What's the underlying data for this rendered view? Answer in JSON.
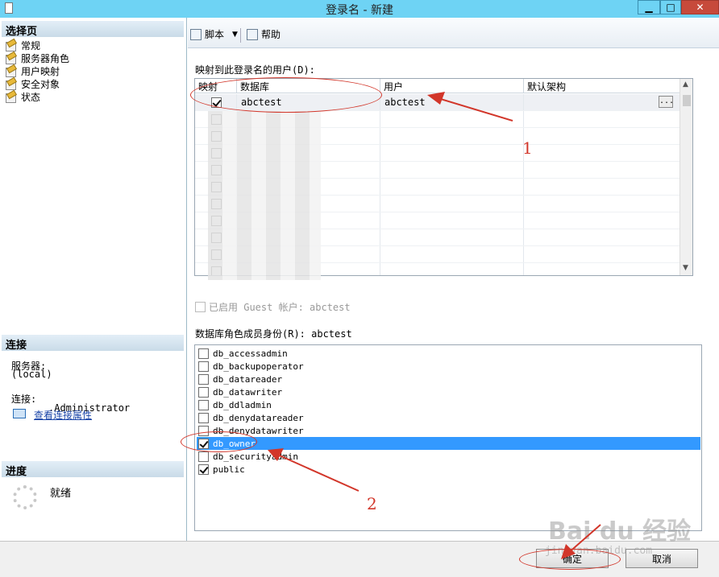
{
  "window": {
    "title": "登录名 - 新建",
    "min_glyph": "▁",
    "max_glyph": "□",
    "close_glyph": "✕"
  },
  "left": {
    "select_page_header": "选择页",
    "pages": [
      "常规",
      "服务器角色",
      "用户映射",
      "安全对象",
      "状态"
    ],
    "connection_header": "连接",
    "server_label": "服务器:",
    "server_value": "(local)",
    "connection_label": "连接:",
    "connection_value": ".Administrator",
    "view_props_link": "查看连接属性",
    "progress_header": "进度",
    "status": "就绪"
  },
  "toolbar": {
    "script_label": "脚本",
    "help_label": "帮助"
  },
  "mapping": {
    "label": "映射到此登录名的用户(D):",
    "columns": [
      "映射",
      "数据库",
      "用户",
      "默认架构"
    ],
    "rows": [
      {
        "checked": true,
        "database": "abctest",
        "user": "abctest",
        "schema": ""
      },
      {
        "checked": false
      },
      {
        "checked": false
      },
      {
        "checked": false
      },
      {
        "checked": false
      },
      {
        "checked": false
      },
      {
        "checked": false
      },
      {
        "checked": false
      },
      {
        "checked": false
      },
      {
        "checked": false
      },
      {
        "checked": false
      }
    ],
    "ellipsis": "..."
  },
  "guest": {
    "label": "已启用 Guest 帐户: abctest",
    "checked": false
  },
  "roles": {
    "label": "数据库角色成员身份(R): abctest",
    "items": [
      {
        "name": "db_accessadmin",
        "checked": false
      },
      {
        "name": "db_backupoperator",
        "checked": false
      },
      {
        "name": "db_datareader",
        "checked": false
      },
      {
        "name": "db_datawriter",
        "checked": false
      },
      {
        "name": "db_ddladmin",
        "checked": false
      },
      {
        "name": "db_denydatareader",
        "checked": false
      },
      {
        "name": "db_denydatawriter",
        "checked": false
      },
      {
        "name": "db_owner",
        "checked": true,
        "highlighted": true
      },
      {
        "name": "db_securityadmin",
        "checked": false
      },
      {
        "name": "public",
        "checked": true
      }
    ]
  },
  "buttons": {
    "ok": "确定",
    "cancel": "取消"
  },
  "annotations": {
    "one": "1",
    "two": "2",
    "color": "#d2362a"
  },
  "watermark": {
    "brand": "Bai du 经验",
    "url": "jingyan.baidu.com"
  }
}
